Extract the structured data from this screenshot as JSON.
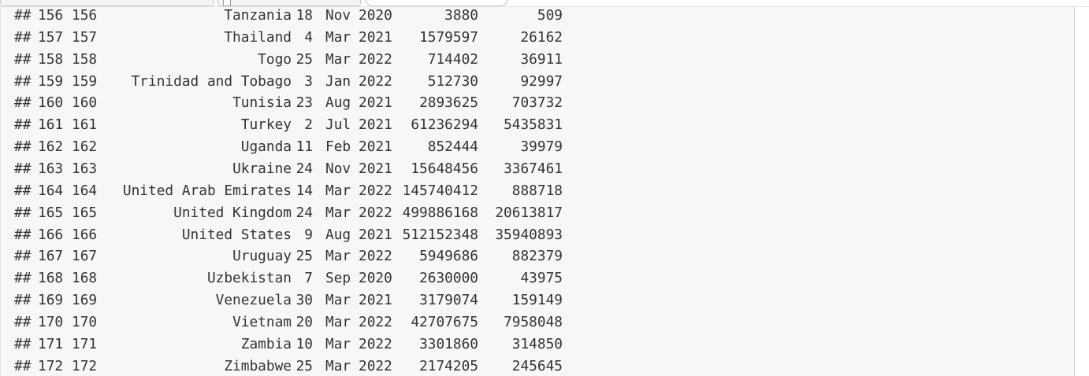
{
  "console": {
    "prefix": "##",
    "rows": [
      {
        "idx": "156",
        "num": "156",
        "country": "Tanzania",
        "day": "18",
        "month": "Nov",
        "year": "2020",
        "v1": "3880",
        "v2": "509"
      },
      {
        "idx": "157",
        "num": "157",
        "country": "Thailand",
        "day": "4",
        "month": "Mar",
        "year": "2021",
        "v1": "1579597",
        "v2": "26162"
      },
      {
        "idx": "158",
        "num": "158",
        "country": "Togo",
        "day": "25",
        "month": "Mar",
        "year": "2022",
        "v1": "714402",
        "v2": "36911"
      },
      {
        "idx": "159",
        "num": "159",
        "country": "Trinidad and Tobago",
        "day": "3",
        "month": "Jan",
        "year": "2022",
        "v1": "512730",
        "v2": "92997"
      },
      {
        "idx": "160",
        "num": "160",
        "country": "Tunisia",
        "day": "23",
        "month": "Aug",
        "year": "2021",
        "v1": "2893625",
        "v2": "703732"
      },
      {
        "idx": "161",
        "num": "161",
        "country": "Turkey",
        "day": "2",
        "month": "Jul",
        "year": "2021",
        "v1": "61236294",
        "v2": "5435831"
      },
      {
        "idx": "162",
        "num": "162",
        "country": "Uganda",
        "day": "11",
        "month": "Feb",
        "year": "2021",
        "v1": "852444",
        "v2": "39979"
      },
      {
        "idx": "163",
        "num": "163",
        "country": "Ukraine",
        "day": "24",
        "month": "Nov",
        "year": "2021",
        "v1": "15648456",
        "v2": "3367461"
      },
      {
        "idx": "164",
        "num": "164",
        "country": "United Arab Emirates",
        "day": "14",
        "month": "Mar",
        "year": "2022",
        "v1": "145740412",
        "v2": "888718"
      },
      {
        "idx": "165",
        "num": "165",
        "country": "United Kingdom",
        "day": "24",
        "month": "Mar",
        "year": "2022",
        "v1": "499886168",
        "v2": "20613817"
      },
      {
        "idx": "166",
        "num": "166",
        "country": "United States",
        "day": "9",
        "month": "Aug",
        "year": "2021",
        "v1": "512152348",
        "v2": "35940893"
      },
      {
        "idx": "167",
        "num": "167",
        "country": "Uruguay",
        "day": "25",
        "month": "Mar",
        "year": "2022",
        "v1": "5949686",
        "v2": "882379"
      },
      {
        "idx": "168",
        "num": "168",
        "country": "Uzbekistan",
        "day": "7",
        "month": "Sep",
        "year": "2020",
        "v1": "2630000",
        "v2": "43975"
      },
      {
        "idx": "169",
        "num": "169",
        "country": "Venezuela",
        "day": "30",
        "month": "Mar",
        "year": "2021",
        "v1": "3179074",
        "v2": "159149"
      },
      {
        "idx": "170",
        "num": "170",
        "country": "Vietnam",
        "day": "20",
        "month": "Mar",
        "year": "2022",
        "v1": "42707675",
        "v2": "7958048"
      },
      {
        "idx": "171",
        "num": "171",
        "country": "Zambia",
        "day": "10",
        "month": "Mar",
        "year": "2022",
        "v1": "3301860",
        "v2": "314850"
      },
      {
        "idx": "172",
        "num": "172",
        "country": "Zimbabwe",
        "day": "25",
        "month": "Mar",
        "year": "2022",
        "v1": "2174205",
        "v2": "245645"
      }
    ]
  },
  "colors": {
    "text": "#333333",
    "background": "#f7f7f7"
  }
}
